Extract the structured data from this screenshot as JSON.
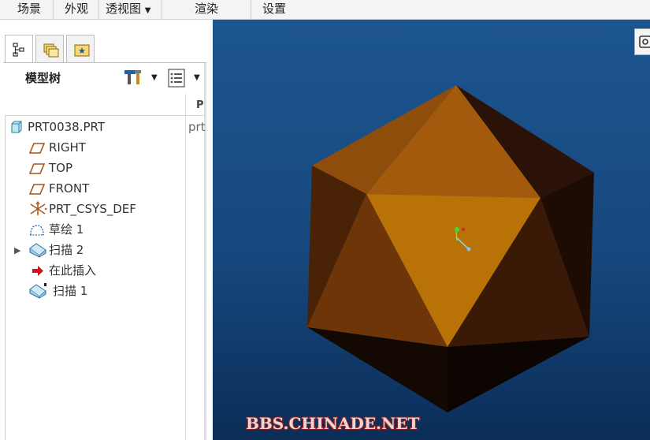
{
  "ribbon": {
    "tabs": [
      {
        "label": "场景"
      },
      {
        "label": "外观"
      },
      {
        "label": "透视图"
      },
      {
        "label": "渲染"
      },
      {
        "label": "设置"
      }
    ]
  },
  "panel": {
    "title": "模型树",
    "column_header": "P"
  },
  "tree": {
    "root": {
      "label": "PRT0038.PRT",
      "col2": "prt"
    },
    "items": [
      {
        "label": "RIGHT",
        "icon": "datum-plane-icon"
      },
      {
        "label": "TOP",
        "icon": "datum-plane-icon"
      },
      {
        "label": "FRONT",
        "icon": "datum-plane-icon"
      },
      {
        "label": "PRT_CSYS_DEF",
        "icon": "coordinate-system-icon"
      },
      {
        "label": "草绘 1",
        "icon": "sketch-icon"
      },
      {
        "label": "扫描 2",
        "icon": "sweep-icon"
      },
      {
        "label": "在此插入",
        "icon": "insert-here-arrow-icon"
      },
      {
        "label": "扫描 1",
        "icon": "sweep-suppressed-icon"
      }
    ]
  },
  "viewport": {
    "watermark": "BBS.CHINADE.NET",
    "model_colors": {
      "top_cap": "#8f4d0b",
      "upper_front": "#a35a0c",
      "front_face": "#b87205",
      "dark_right": "#2a1208",
      "bottom": "#140802"
    }
  }
}
